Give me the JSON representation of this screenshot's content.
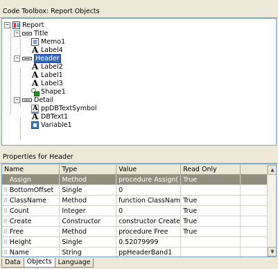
{
  "tree_panel": {
    "title": "Code Toolbox: Report Objects",
    "nodes": [
      {
        "label": "Report",
        "icon": "report-icon"
      },
      {
        "label": "Title",
        "icon": "band-icon"
      },
      {
        "label": "Memo1",
        "icon": "memo-icon"
      },
      {
        "label": "Label4",
        "icon": "label-icon"
      },
      {
        "label": "Header",
        "icon": "band-icon"
      },
      {
        "label": "Label2",
        "icon": "label-icon"
      },
      {
        "label": "Label1",
        "icon": "label-icon"
      },
      {
        "label": "Label3",
        "icon": "label-icon"
      },
      {
        "label": "Shape1",
        "icon": "shape-icon"
      },
      {
        "label": "Detail",
        "icon": "band-icon"
      },
      {
        "label": "ppDBTextSymbol",
        "icon": "dbtextsymbol-icon"
      },
      {
        "label": "DBText1",
        "icon": "dbtext-icon"
      },
      {
        "label": "Variable1",
        "icon": "variable-icon"
      }
    ],
    "selected": "Header"
  },
  "props_panel": {
    "title": "Properties for Header",
    "columns": [
      "Name",
      "Type",
      "Value",
      "Read Only"
    ],
    "rows": [
      {
        "name": "Assign",
        "type": "Method",
        "value": "procedure Assign(",
        "readonly": "True"
      },
      {
        "name": "BottomOffset",
        "type": "Single",
        "value": "0",
        "readonly": ""
      },
      {
        "name": "ClassName",
        "type": "Method",
        "value": "function ClassNam",
        "readonly": "True"
      },
      {
        "name": "Count",
        "type": "Integer",
        "value": "0",
        "readonly": "True"
      },
      {
        "name": "Create",
        "type": "Constructor",
        "value": "constructor Create",
        "readonly": "True"
      },
      {
        "name": "Free",
        "type": "Method",
        "value": "procedure Free",
        "readonly": "True"
      },
      {
        "name": "Height",
        "type": "Single",
        "value": "0.52079999",
        "readonly": ""
      },
      {
        "name": "Name",
        "type": "String",
        "value": "ppHeaderBand1",
        "readonly": ""
      }
    ]
  },
  "tabs": [
    "Data",
    "Objects",
    "Language"
  ],
  "active_tab": "Objects"
}
